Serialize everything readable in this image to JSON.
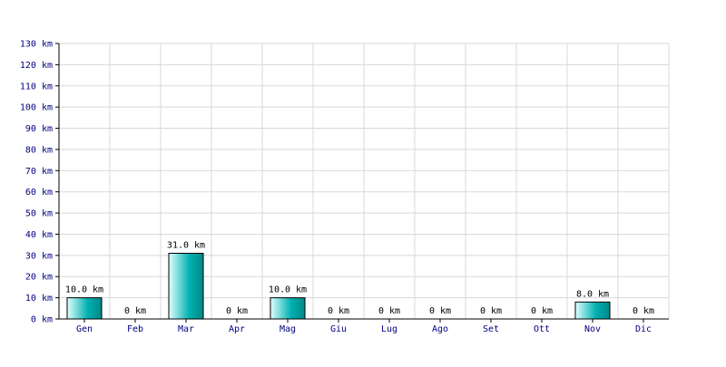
{
  "chart_data": {
    "type": "bar",
    "categories": [
      "Gen",
      "Feb",
      "Mar",
      "Apr",
      "Mag",
      "Giu",
      "Lug",
      "Ago",
      "Set",
      "Ott",
      "Nov",
      "Dic"
    ],
    "values": [
      10.0,
      0,
      31.0,
      0,
      10.0,
      0,
      0,
      0,
      0,
      0,
      8.0,
      0
    ],
    "data_labels": [
      "10.0 km",
      "0 km",
      "31.0 km",
      "0 km",
      "10.0 km",
      "0 km",
      "0 km",
      "0 km",
      "0 km",
      "0 km",
      "8.0 km",
      "0 km"
    ],
    "y_ticks": [
      0,
      10,
      20,
      30,
      40,
      50,
      60,
      70,
      80,
      90,
      100,
      110,
      120,
      130
    ],
    "y_tick_labels": [
      "0 km",
      "10 km",
      "20 km",
      "30 km",
      "40 km",
      "50 km",
      "60 km",
      "70 km",
      "80 km",
      "90 km",
      "100 km",
      "110 km",
      "120 km",
      "130 km"
    ],
    "ylim": [
      0,
      130
    ],
    "grid": true,
    "legend": "none",
    "title": "",
    "xlabel": "",
    "ylabel": "",
    "colors": {
      "bar_light": "#e0ffff",
      "bar_dark": "#00b0b0",
      "bar_edge": "#000000",
      "grid": "#d8d8d8",
      "axis": "#000000",
      "tick_text": "#000080"
    }
  }
}
